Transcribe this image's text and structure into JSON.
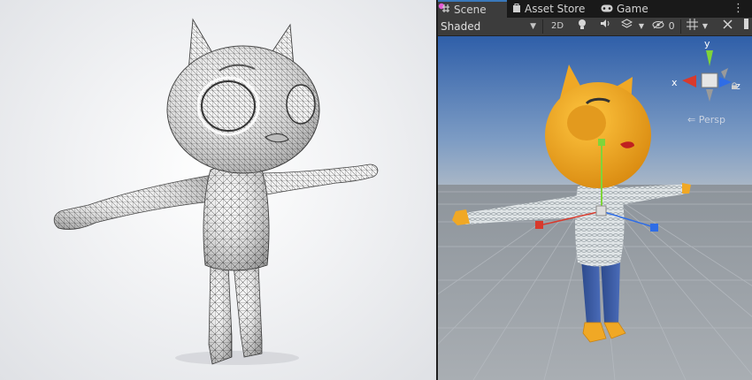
{
  "tabs": [
    {
      "label": "Scene",
      "icon": "scene-hash-icon",
      "active": true
    },
    {
      "label": "Asset Store",
      "icon": "shopping-bag-icon",
      "active": false
    },
    {
      "label": "Game",
      "icon": "gamepad-icon",
      "active": false
    }
  ],
  "toolbar": {
    "shading_mode": "Shaded",
    "mode_2d": "2D",
    "hidden_count": "0"
  },
  "gizmo": {
    "x_label": "x",
    "y_label": "y",
    "z_label": "z",
    "projection_label": "Persp"
  },
  "colors": {
    "tab_accent": "#3a79bb",
    "gizmo_x": "#d83a2d",
    "gizmo_y": "#7fd43a",
    "gizmo_z": "#2f6de6",
    "character_head": "#f0a825",
    "sweater": "#dfe4e6",
    "jeans": "#3a5ca8"
  }
}
